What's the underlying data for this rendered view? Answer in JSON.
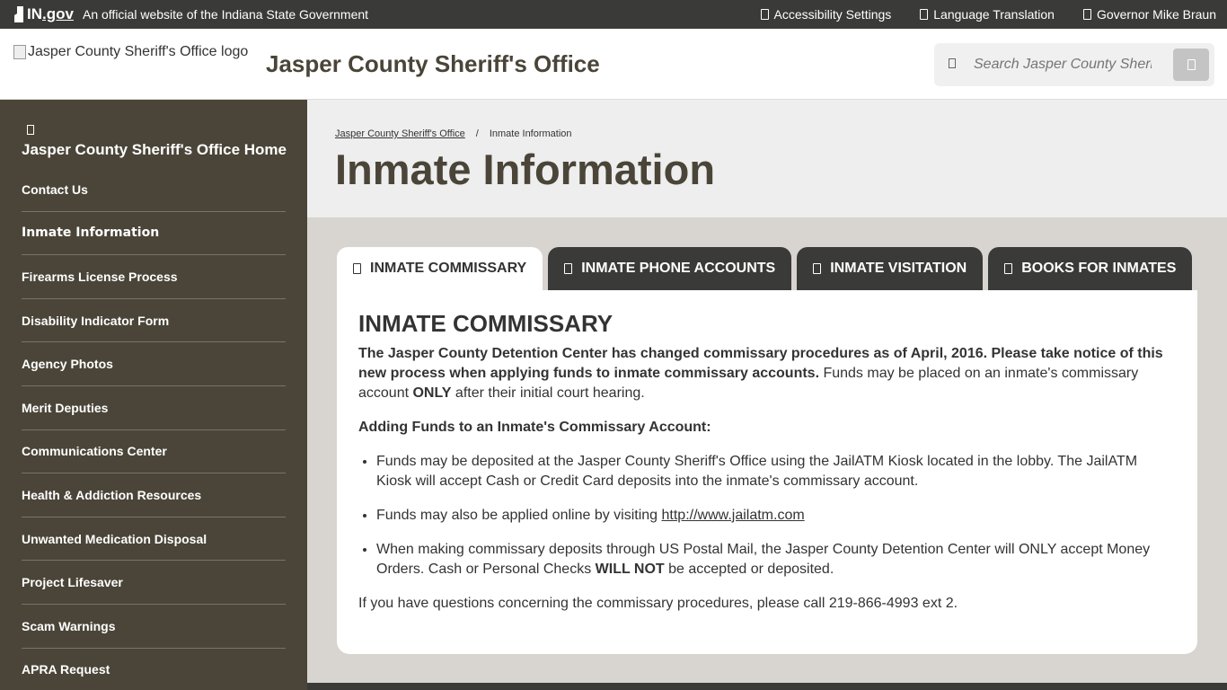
{
  "state_bar": {
    "logo_in": "IN",
    "logo_gov": ".gov",
    "tagline": "An official website of the Indiana State Government",
    "links": [
      "Accessibility Settings",
      "Language Translation",
      "Governor Mike Braun"
    ]
  },
  "header": {
    "logo_alt": "Jasper County Sheriff's Office logo",
    "title": "Jasper County Sheriff's Office",
    "search_placeholder": "Search Jasper County Sheriff's Office"
  },
  "sidebar": {
    "home": "Jasper County Sheriff's Office Home",
    "items": [
      "Contact Us",
      "Inmate Information",
      "Firearms License Process",
      "Disability Indicator Form",
      "Agency Photos",
      "Merit Deputies",
      "Communications Center",
      "Health & Addiction Resources",
      "Unwanted Medication Disposal",
      "Project Lifesaver",
      "Scam Warnings",
      "APRA Request"
    ]
  },
  "breadcrumb": {
    "home": "Jasper County Sheriff's Office",
    "separator": "/",
    "current": "Inmate Information"
  },
  "page_title": "Inmate Information",
  "tabs": [
    "INMATE COMMISSARY",
    "INMATE PHONE ACCOUNTS",
    "INMATE VISITATION",
    "BOOKS FOR INMATES"
  ],
  "panel": {
    "heading": "INMATE COMMISSARY",
    "intro_bold": "The Jasper County Detention Center has changed commissary procedures as of April, 2016. Please take notice of this new process when applying funds to inmate commissary accounts.",
    "intro_rest_1": " Funds may be placed on an inmate's commissary account ",
    "intro_only": "ONLY",
    "intro_rest_2": " after their initial court hearing.",
    "subheading": "Adding Funds to an Inmate's Commissary Account:",
    "bullet1": "Funds may be deposited at the Jasper County Sheriff's Office using the JailATM Kiosk located in the lobby. The JailATM Kiosk will accept Cash or Credit Card deposits into the inmate's commissary account.",
    "bullet2_text": "Funds may also be applied online by visiting ",
    "bullet2_link": "http://www.jailatm.com",
    "bullet3_text": "When making commissary deposits through US Postal Mail, the Jasper County Detention Center will ONLY accept Money Orders. Cash or Personal Checks ",
    "bullet3_bold": "WILL NOT",
    "bullet3_end": " be accepted or deposited.",
    "closing": "If you have questions concerning the commissary procedures, please call 219-866-4993 ext 2."
  }
}
